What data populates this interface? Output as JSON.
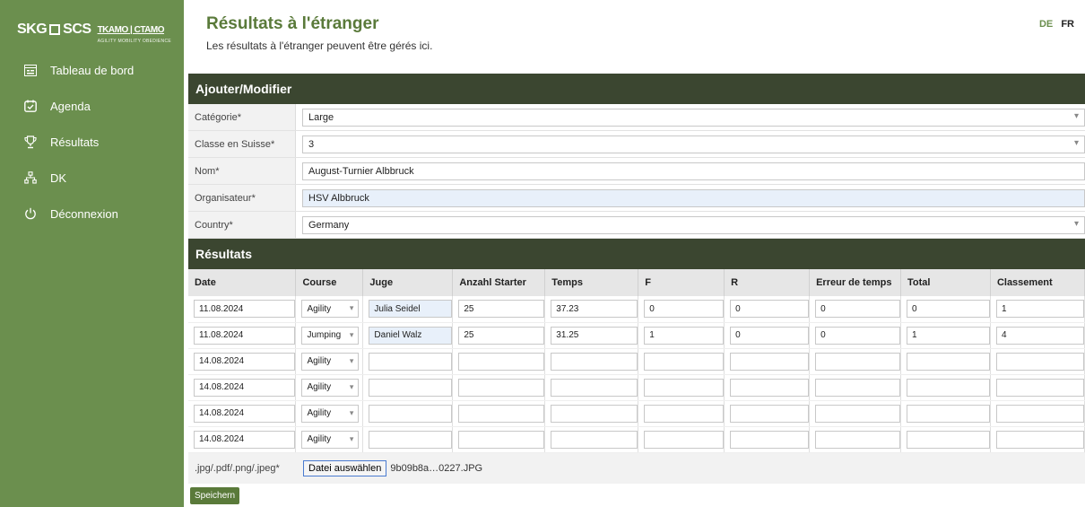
{
  "sidebar": {
    "logo_main": "SKG",
    "logo_mid": "SCS",
    "logo_right": "TKAMO | CTAMO",
    "logo_sub_left": "AGILITY MOBILITY OBEDIENCE",
    "items": [
      {
        "label": "Tableau de bord",
        "icon": "dashboard-icon"
      },
      {
        "label": "Agenda",
        "icon": "calendar-check-icon"
      },
      {
        "label": "Résultats",
        "icon": "trophy-icon"
      },
      {
        "label": "DK",
        "icon": "hierarchy-icon"
      },
      {
        "label": "Déconnexion",
        "icon": "power-icon"
      }
    ]
  },
  "header": {
    "title": "Résultats à l'étranger",
    "subtitle": "Les résultats à l'étranger peuvent être gérés ici.",
    "lang_de": "DE",
    "lang_fr": "FR"
  },
  "form": {
    "section_title": "Ajouter/Modifier",
    "fields": [
      {
        "label": "Catégorie*",
        "value": "Large"
      },
      {
        "label": "Classe en Suisse*",
        "value": "3"
      },
      {
        "label": "Nom*",
        "value": "August-Turnier Albbruck"
      },
      {
        "label": "Organisateur*",
        "value": "HSV Albbruck"
      },
      {
        "label": "Country*",
        "value": "Germany"
      }
    ]
  },
  "results": {
    "section_title": "Résultats",
    "columns": [
      "Date",
      "Course",
      "Juge",
      "Anzahl Starter",
      "Temps",
      "F",
      "R",
      "Erreur de temps",
      "Total",
      "Classement"
    ],
    "rows": [
      {
        "date": "11.08.2024",
        "course": "Agility",
        "juge": "Julia Seidel",
        "starter": "25",
        "temps": "37.23",
        "f": "0",
        "r": "0",
        "erreur": "0",
        "total": "0",
        "classement": "1"
      },
      {
        "date": "11.08.2024",
        "course": "Jumping",
        "juge": "Daniel Walz",
        "starter": "25",
        "temps": "31.25",
        "f": "1",
        "r": "0",
        "erreur": "0",
        "total": "1",
        "classement": "4"
      },
      {
        "date": "14.08.2024",
        "course": "Agility",
        "juge": "",
        "starter": "",
        "temps": "",
        "f": "",
        "r": "",
        "erreur": "",
        "total": "",
        "classement": ""
      },
      {
        "date": "14.08.2024",
        "course": "Agility",
        "juge": "",
        "starter": "",
        "temps": "",
        "f": "",
        "r": "",
        "erreur": "",
        "total": "",
        "classement": ""
      },
      {
        "date": "14.08.2024",
        "course": "Agility",
        "juge": "",
        "starter": "",
        "temps": "",
        "f": "",
        "r": "",
        "erreur": "",
        "total": "",
        "classement": ""
      },
      {
        "date": "14.08.2024",
        "course": "Agility",
        "juge": "",
        "starter": "",
        "temps": "",
        "f": "",
        "r": "",
        "erreur": "",
        "total": "",
        "classement": ""
      }
    ],
    "file_label": ".jpg/.pdf/.png/.jpeg*",
    "file_button": "Datei auswählen",
    "file_name": "9b09b8a…0227.JPG",
    "save_label": "Speichern"
  }
}
